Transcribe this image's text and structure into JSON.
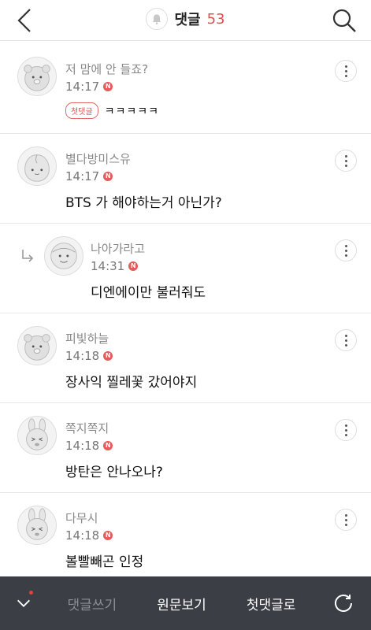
{
  "header": {
    "title": "댓글",
    "count": "53",
    "accent_color": "#e24d4d",
    "back_icon": "chevron-left-icon",
    "search_icon": "search-icon",
    "bell_icon": "bell-icon"
  },
  "comments": [
    {
      "author": "저 맘에 안 들죠?",
      "time": "14:17",
      "badge": "N",
      "first_tag": "첫댓글",
      "text": "ㅋㅋㅋㅋㅋ"
    },
    {
      "author": "별다방미스유",
      "time": "14:17",
      "badge": "N",
      "text": "BTS 가 해야하는거 아닌가?"
    },
    {
      "author": "나아가라고",
      "time": "14:31",
      "badge": "N",
      "text": "디엔에이만 불러줘도",
      "is_reply": true
    },
    {
      "author": "피빛하늘",
      "time": "14:18",
      "badge": "N",
      "text": "장사익 찔레꽃 갔어야지"
    },
    {
      "author": "쪽지쪽지",
      "time": "14:18",
      "badge": "N",
      "text": "방탄은 안나오나?"
    },
    {
      "author": "다무시",
      "time": "14:18",
      "badge": "N",
      "text": "볼빨빼곤 인정"
    }
  ],
  "bottom_bar": {
    "write": "댓글쓰기",
    "original": "원문보기",
    "first_comment": "첫댓글로",
    "refresh_icon": "refresh-icon",
    "down_icon": "chevron-down-icon"
  }
}
